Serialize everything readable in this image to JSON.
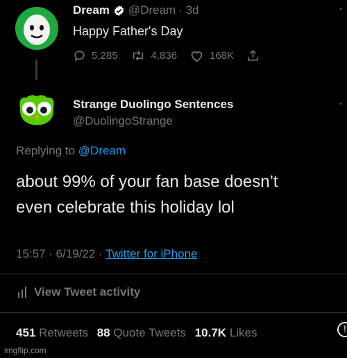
{
  "original_tweet": {
    "author_name": "Dream",
    "author_handle": "@Dream",
    "age": "· 3d",
    "text": "Happy Father's Day",
    "stats": {
      "replies": "5,285",
      "retweets": "4,836",
      "likes": "168K"
    }
  },
  "reply_tweet": {
    "author_name": "Strange Duolingo Sentences",
    "author_handle": "@DuolingoStrange",
    "replying_to_prefix": "Replying to",
    "replying_to_handle": "@Dream",
    "text_line1": "about 99% of your fan base doesn’t",
    "text_line2": "even celebrate this holiday lol",
    "timestamp": "15:57 · 6/19/22 ·",
    "source": "Twitter for iPhone",
    "view_activity": "View Tweet activity",
    "counts": {
      "retweets_value": "451",
      "retweets_label": "Retweets",
      "quotes_value": "88",
      "quotes_label": "Quote Tweets",
      "likes_value": "10.7K",
      "likes_label": "Likes"
    }
  },
  "watermark": "imgflip.com",
  "colors": {
    "background": "#000000",
    "text": "#e7e9ea",
    "secondary": "#71767b",
    "link": "#1d9bf0",
    "verified": "#ffffff",
    "dream_avatar_bg": "#1fa83f",
    "duolingo_green": "#58cc02"
  },
  "icons": [
    "verified-badge-icon",
    "reply-icon",
    "retweet-icon",
    "like-icon",
    "share-icon",
    "analytics-icon",
    "more-icon",
    "info-icon"
  ]
}
